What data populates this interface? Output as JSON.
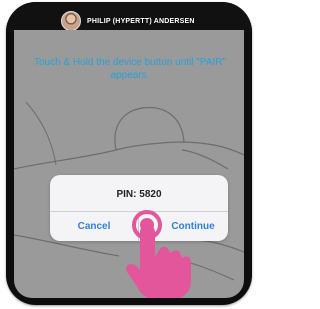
{
  "header": {
    "title": "PHILIP (HYPERTT) ANDERSEN"
  },
  "instructions": {
    "text": "Touch & Hold the device button until \"PAIR\" appears."
  },
  "dialog": {
    "message": "PIN: 5820",
    "cancel_label": "Cancel",
    "continue_label": "Continue"
  },
  "colors": {
    "instruction_text": "#2a9fdc",
    "dialog_button_text": "#2f7fe0",
    "tap_indicator": "#e3569b",
    "screen_overlay": "#9a9a9a"
  },
  "icons": {
    "avatar": "avatar",
    "hand": "tap-hand-icon",
    "tap": "tap-indicator-icon"
  }
}
